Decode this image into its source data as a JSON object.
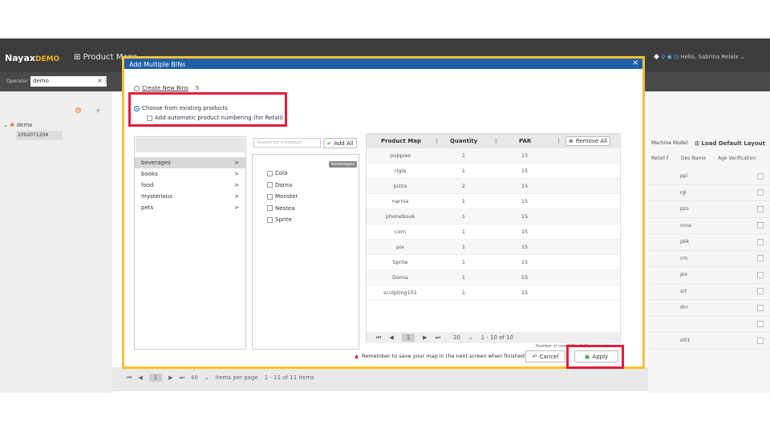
{
  "app": {
    "logo": "Nayax",
    "logo_suffix": "DEMO",
    "name": "Product Maps",
    "user": "Hello, Sabrina Relaix",
    "operator_label": "Operator",
    "operator_value": "demo",
    "tree_root": "demo",
    "tree_item": "2002071204",
    "right_header": "Machine Model:",
    "load_layout": "Load Default Layout",
    "col_retail": "Retail F",
    "col_desname": "Des Name",
    "col_age": "Age Verification",
    "right_rows": [
      "ppi",
      "rgl",
      "pzo",
      "nrna",
      "pbk",
      "crn",
      "pix",
      "srt",
      "drn",
      "",
      "sl01"
    ],
    "pager_per_page": "40",
    "pager_items_label": "items per page",
    "pager_summary": "1 - 11 of 11 items",
    "colors": {
      "topbar": "#3d3d3d",
      "accent": "#f0b020"
    }
  },
  "modal": {
    "title": "Add Multiple BINs",
    "close": "×",
    "option_new": "Create New Bins",
    "option_new_count": "5",
    "option_existing": "Choose from existing products",
    "auto_numbering": "Add automatic product numbering (for Retail)",
    "search_placeholder": "Search for a product",
    "add_all": "Add All",
    "categories": [
      {
        "name": "beverages",
        "selected": true
      },
      {
        "name": "books",
        "selected": false
      },
      {
        "name": "food",
        "selected": false
      },
      {
        "name": "mysterious",
        "selected": false
      },
      {
        "name": "pets",
        "selected": false
      }
    ],
    "category_arrow": ">",
    "product_tag": "beverages",
    "products": [
      "Cola",
      "Dorna",
      "Monster",
      "Nestea",
      "Sprite"
    ],
    "table": {
      "headers": [
        "Product Map",
        "Quantity",
        "PAR"
      ],
      "remove_all": "Remove All",
      "rows": [
        [
          "puppies",
          "1",
          "15"
        ],
        [
          "rigla",
          "1",
          "15"
        ],
        [
          "pizza",
          "2",
          "15"
        ],
        [
          "narnia",
          "1",
          "15"
        ],
        [
          "phonebook",
          "1",
          "15"
        ],
        [
          "corn",
          "1",
          "15"
        ],
        [
          "pix",
          "1",
          "15"
        ],
        [
          "Sprite",
          "1",
          "15"
        ],
        [
          "Dorna",
          "1",
          "15"
        ],
        [
          "sculpting101",
          "1",
          "15"
        ]
      ],
      "page": "1",
      "page_size": "20",
      "summary": "1 - 10 of 10"
    },
    "bins_note": "Number of new BINs: 0 (0 products)",
    "warning": "Remember to save your map in the next screen when finished",
    "cancel": "Cancel",
    "apply": "Apply"
  }
}
